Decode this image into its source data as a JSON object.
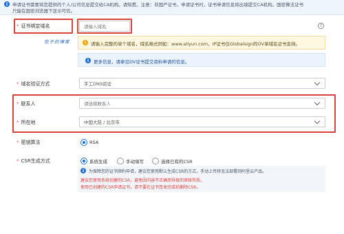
{
  "notice_top": {
    "line1": "申请证书需要将您提供的个人/公司信息提交给CA机构。请知悉，注意：非国产证书，申请证书时，证书申请信息将出境提交CA机构。国密算法证书",
    "line2": "只能在国密浏览器下显示可信。"
  },
  "form": {
    "domain": {
      "label": "证书绑定域名",
      "placeholder": "请输入域名"
    },
    "domain_tip": "请输入完整的单个域名，域名格式例如：www.aliyun.com，IP证书仅Globalsign的OV单域名证书支持。",
    "dv_tip": "更多信息，请参见DV证书提交资料申请的信息。",
    "validation": {
      "label": "域名验证方式",
      "value": "手工DNS验证"
    },
    "contact": {
      "label": "联系人",
      "placeholder": "请选择联系人"
    },
    "location": {
      "label": "所在地",
      "value": "中国大陆 / 北京市"
    },
    "algorithm": {
      "label": "密钥算法",
      "option": "RSA"
    },
    "csr": {
      "label": "CSR生成方式",
      "options": [
        "系统生成",
        "手动填写",
        "选择已有的CSR"
      ],
      "note_line1": "为保障您的证书顺利申请，建议您使用默认生成CSR的方式，手动上传将无法部署到阿里云产品。",
      "note_line2": "建议您使用系统创建的CSR，避免因内容不正确而导致的审核失败。",
      "note_line3": "使用已创建的CSR申请证书，请不要在证书签发完成前删除CSR。"
    }
  },
  "watermark": "包子的博客",
  "help_glyph": "?",
  "info_glyph": "i",
  "warn_glyph": "!",
  "required_mark": "*"
}
